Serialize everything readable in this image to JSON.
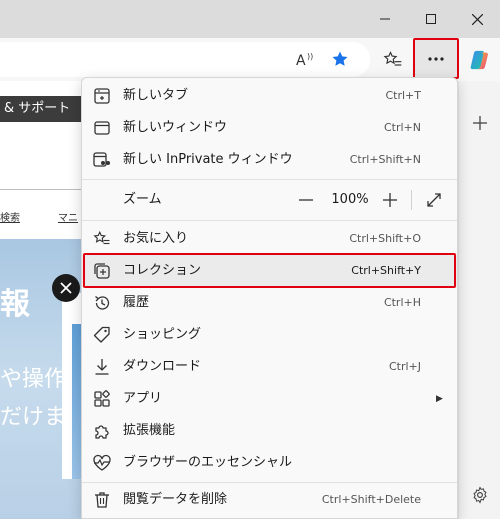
{
  "page": {
    "support_label": "& サポート",
    "nav_link_1": "検索",
    "nav_link_2": "マニ",
    "hero_big": "報",
    "hero_line_1": "や操作",
    "hero_line_2": "だけま"
  },
  "menu": {
    "items": [
      {
        "label": "新しいタブ",
        "shortcut": "Ctrl+T",
        "icon": "new-tab-icon"
      },
      {
        "label": "新しいウィンドウ",
        "shortcut": "Ctrl+N",
        "icon": "new-window-icon"
      },
      {
        "label": "新しい InPrivate ウィンドウ",
        "shortcut": "Ctrl+Shift+N",
        "icon": "inprivate-icon"
      },
      {
        "label": "お気に入り",
        "shortcut": "Ctrl+Shift+O",
        "icon": "favorites-icon"
      },
      {
        "label": "コレクション",
        "shortcut": "Ctrl+Shift+Y",
        "icon": "collections-icon"
      },
      {
        "label": "履歴",
        "shortcut": "Ctrl+H",
        "icon": "history-icon"
      },
      {
        "label": "ショッピング",
        "shortcut": "",
        "icon": "shopping-tag-icon"
      },
      {
        "label": "ダウンロード",
        "shortcut": "Ctrl+J",
        "icon": "download-icon"
      },
      {
        "label": "アプリ",
        "shortcut": "",
        "icon": "apps-icon"
      },
      {
        "label": "拡張機能",
        "shortcut": "",
        "icon": "extensions-icon"
      },
      {
        "label": "ブラウザーのエッセンシャル",
        "shortcut": "",
        "icon": "browser-essentials-icon"
      },
      {
        "label": "閲覧データを削除",
        "shortcut": "Ctrl+Shift+Delete",
        "icon": "delete-icon"
      }
    ],
    "zoom": {
      "label": "ズーム",
      "value": "100%"
    },
    "highlighted_item": "コレクション"
  },
  "colors": {
    "highlight_border": "#e1000f",
    "favorite_star": "#1a73e8"
  }
}
